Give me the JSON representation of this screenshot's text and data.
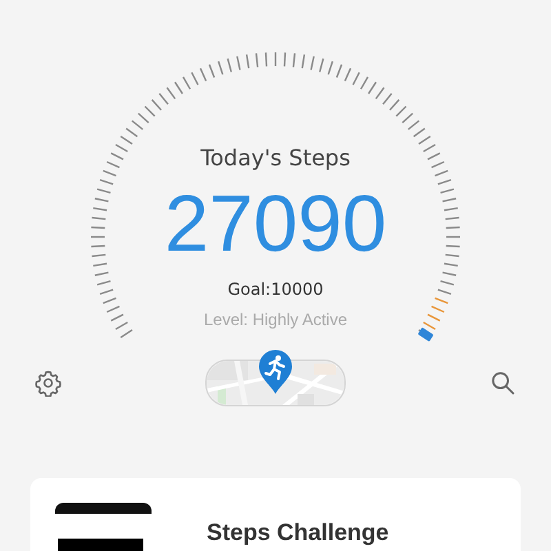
{
  "steps": {
    "title": "Today's Steps",
    "count": "27090",
    "goal": "Goal:10000",
    "activity_level": "Level: Highly Active"
  },
  "card": {
    "title": "Steps Challenge"
  }
}
